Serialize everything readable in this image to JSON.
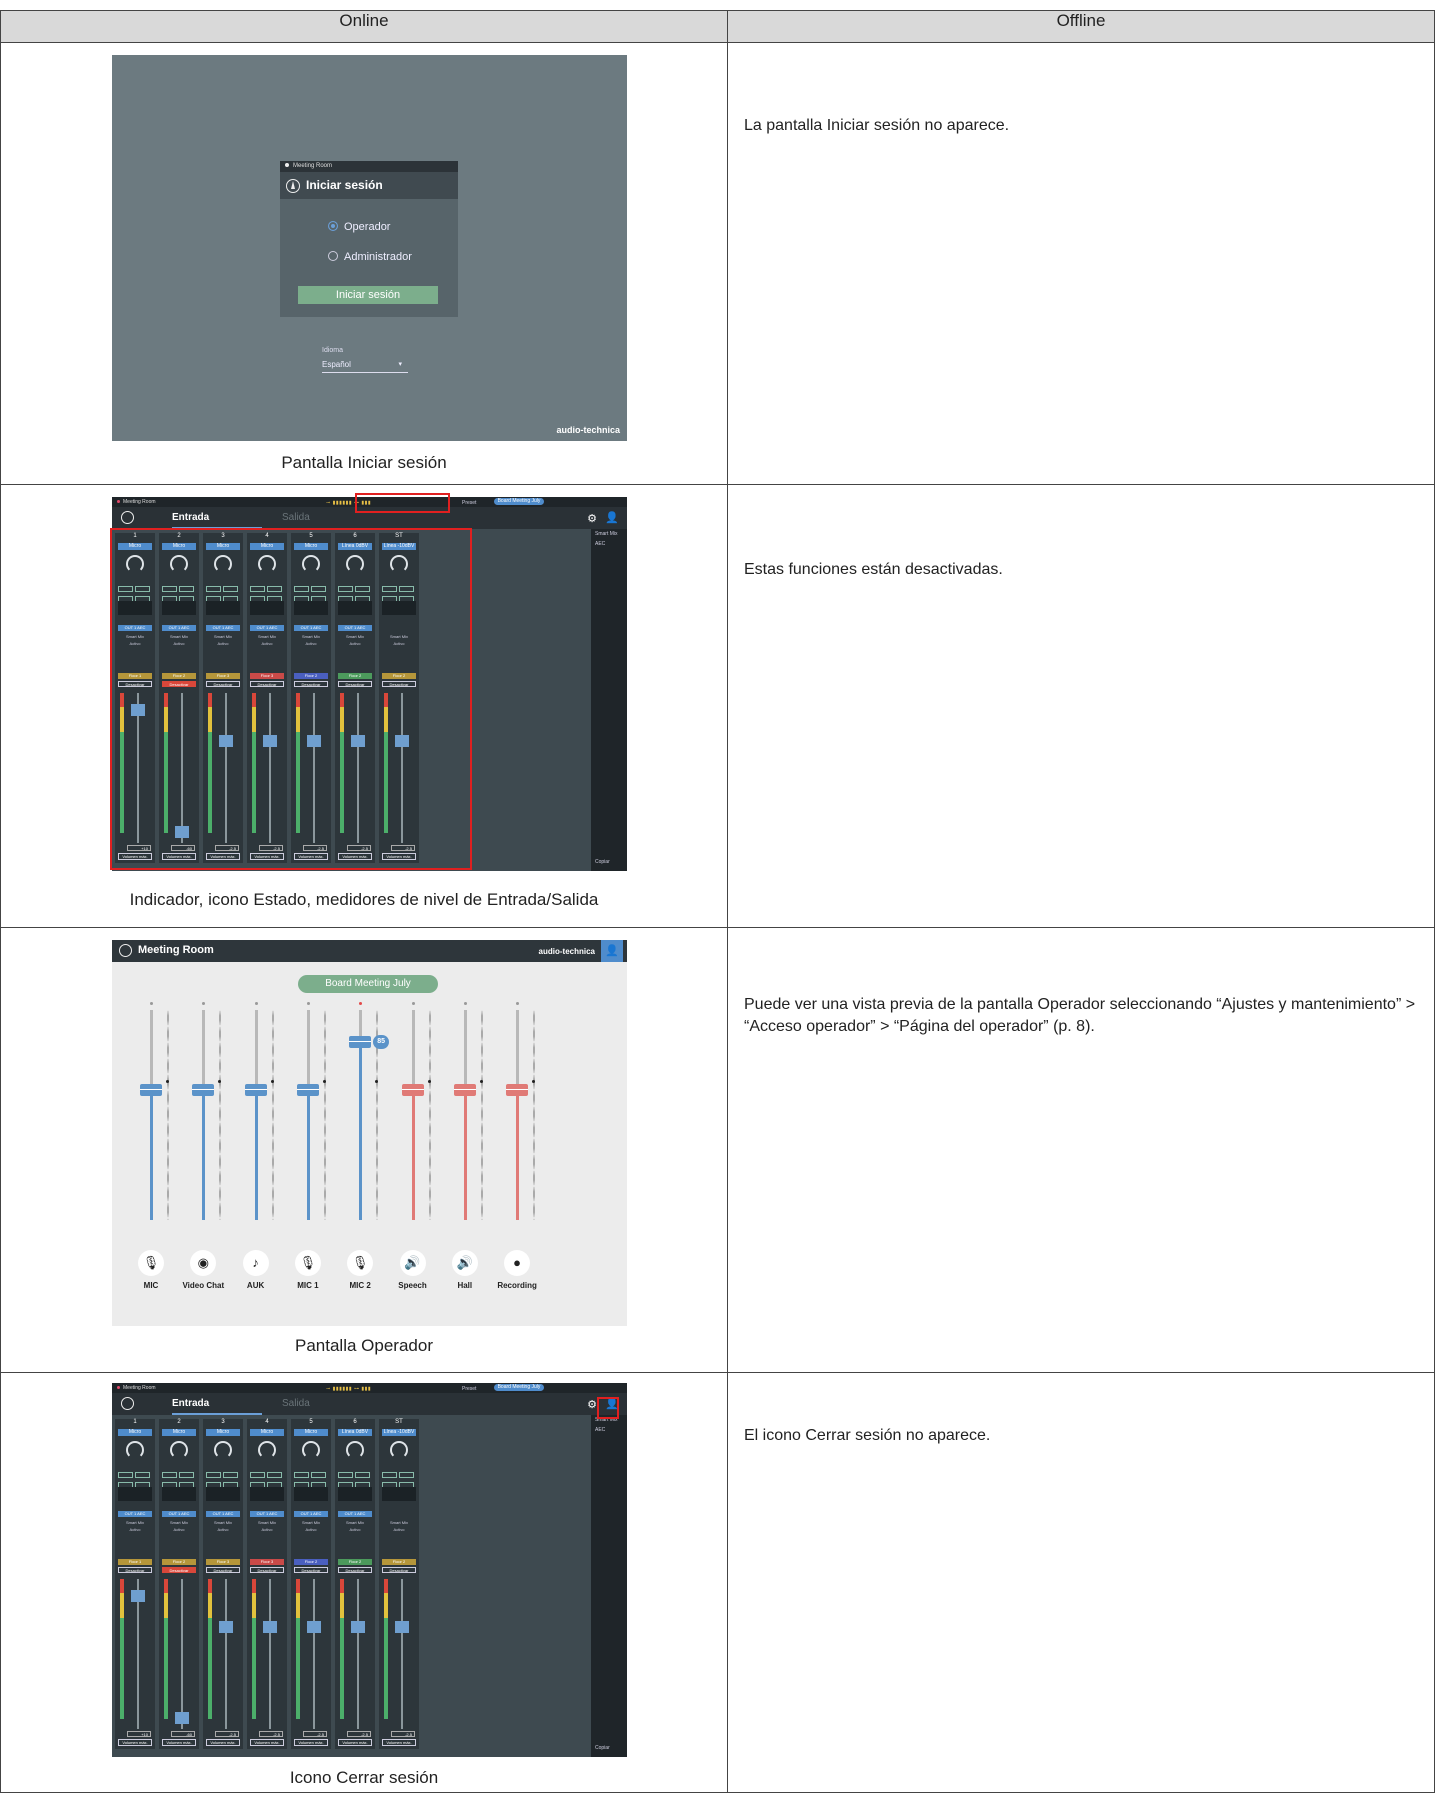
{
  "headers": {
    "online": "Online",
    "offline": "Offline"
  },
  "rows": [
    {
      "caption": "Pantalla Iniciar sesión",
      "offline": "La pantalla Iniciar sesión no aparece."
    },
    {
      "caption": "Indicador, icono Estado, medidores de nivel de Entrada/Salida",
      "offline": "Estas funciones están desactivadas."
    },
    {
      "caption": "Pantalla Operador",
      "offline": "Puede ver una vista previa de la pantalla Operador seleccionando “Ajustes y mantenimiento” > “Acceso operador” > “Página del operador” (p. 8)."
    },
    {
      "caption": "Icono Cerrar sesión",
      "offline": "El icono Cerrar sesión no aparece."
    }
  ],
  "login": {
    "app": "Meeting Room",
    "title": "Iniciar sesión",
    "roles": [
      "Operador",
      "Administrador"
    ],
    "button": "Iniciar sesión",
    "language_label": "Idioma",
    "language_value": "Español",
    "brand": "audio-technica"
  },
  "mixer": {
    "app": "Meeting Room",
    "tab_input": "Entrada",
    "tab_output": "Salida",
    "preset_label": "Preset",
    "preset_value": "Board Meeting July",
    "channels": [
      {
        "num": "1",
        "src": "Micro",
        "zone": "Floor 1",
        "zone_color": "#b5963a",
        "mute": "Desactivar",
        "value": "+10",
        "fader": 0.92
      },
      {
        "num": "2",
        "src": "Micro",
        "zone": "Floor 2",
        "zone_color": "#b5963a",
        "mute": "Desactivar",
        "value": "-60",
        "fader": 0.05
      },
      {
        "num": "3",
        "src": "Micro",
        "zone": "Floor 3",
        "zone_color": "#b5963a",
        "mute": "Desactivar",
        "value": "-2.5",
        "fader": 0.7
      },
      {
        "num": "4",
        "src": "Micro",
        "zone": "Floor 3",
        "zone_color": "#c94a48",
        "mute": "Desactivar",
        "value": "-2.5",
        "fader": 0.7
      },
      {
        "num": "5",
        "src": "Micro",
        "zone": "Floor 2",
        "zone_color": "#4a5fbf",
        "mute": "Desactivar",
        "value": "-2.5",
        "fader": 0.7
      },
      {
        "num": "6",
        "src": "Línea 0dBV",
        "zone": "Floor 2",
        "zone_color": "#4c9a5c",
        "mute": "Desactivar",
        "value": "-2.5",
        "fader": 0.7
      },
      {
        "num": "ST",
        "src": "Línea -10dBV",
        "zone": "Floor 2",
        "zone_color": "#b5963a",
        "mute": "Desactivar",
        "value": "-2.5",
        "fader": 0.7
      }
    ],
    "strip_labels": {
      "aec": "OUT 1 AEC",
      "smart": "Smart Mix",
      "active": "Activo",
      "vmax": "Volumen máx."
    },
    "side": {
      "smart_mix": "Smart Mix",
      "aec": "AEC",
      "copy": "Copiar"
    }
  },
  "operator": {
    "app": "Meeting Room",
    "brand": "audio-technica",
    "preset": "Board Meeting July",
    "bubble": "85",
    "channels": [
      {
        "label": "MIC",
        "icon": "🎙",
        "level": 0.62,
        "color": "blue",
        "led": "grey"
      },
      {
        "label": "Video Chat",
        "icon": "◉",
        "level": 0.62,
        "color": "blue",
        "led": "grey"
      },
      {
        "label": "AUK",
        "icon": "♪",
        "level": 0.62,
        "color": "blue",
        "led": "grey"
      },
      {
        "label": "MIC 1",
        "icon": "🎙",
        "level": 0.62,
        "color": "blue",
        "led": "grey"
      },
      {
        "label": "MIC 2",
        "icon": "🎙",
        "level": 0.85,
        "color": "blue",
        "led": "red"
      },
      {
        "label": "Speech",
        "icon": "🔊",
        "level": 0.62,
        "color": "red",
        "led": "grey"
      },
      {
        "label": "Hall",
        "icon": "🔊",
        "level": 0.62,
        "color": "red",
        "led": "grey"
      },
      {
        "label": "Recording",
        "icon": "●",
        "level": 0.62,
        "color": "red",
        "led": "grey"
      }
    ]
  }
}
